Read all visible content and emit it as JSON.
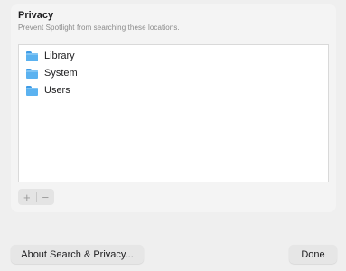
{
  "header": {
    "title": "Privacy",
    "subtitle": "Prevent Spotlight from searching these locations."
  },
  "locations": [
    {
      "label": "Library",
      "icon": "folder-icon"
    },
    {
      "label": "System",
      "icon": "folder-icon"
    },
    {
      "label": "Users",
      "icon": "folder-icon"
    }
  ],
  "controls": {
    "add_label": "+",
    "remove_label": "−"
  },
  "footer": {
    "about_label": "About Search & Privacy...",
    "done_label": "Done"
  },
  "colors": {
    "folder": "#5bb2f0",
    "background": "#efefef",
    "list_background": "#ffffff"
  }
}
